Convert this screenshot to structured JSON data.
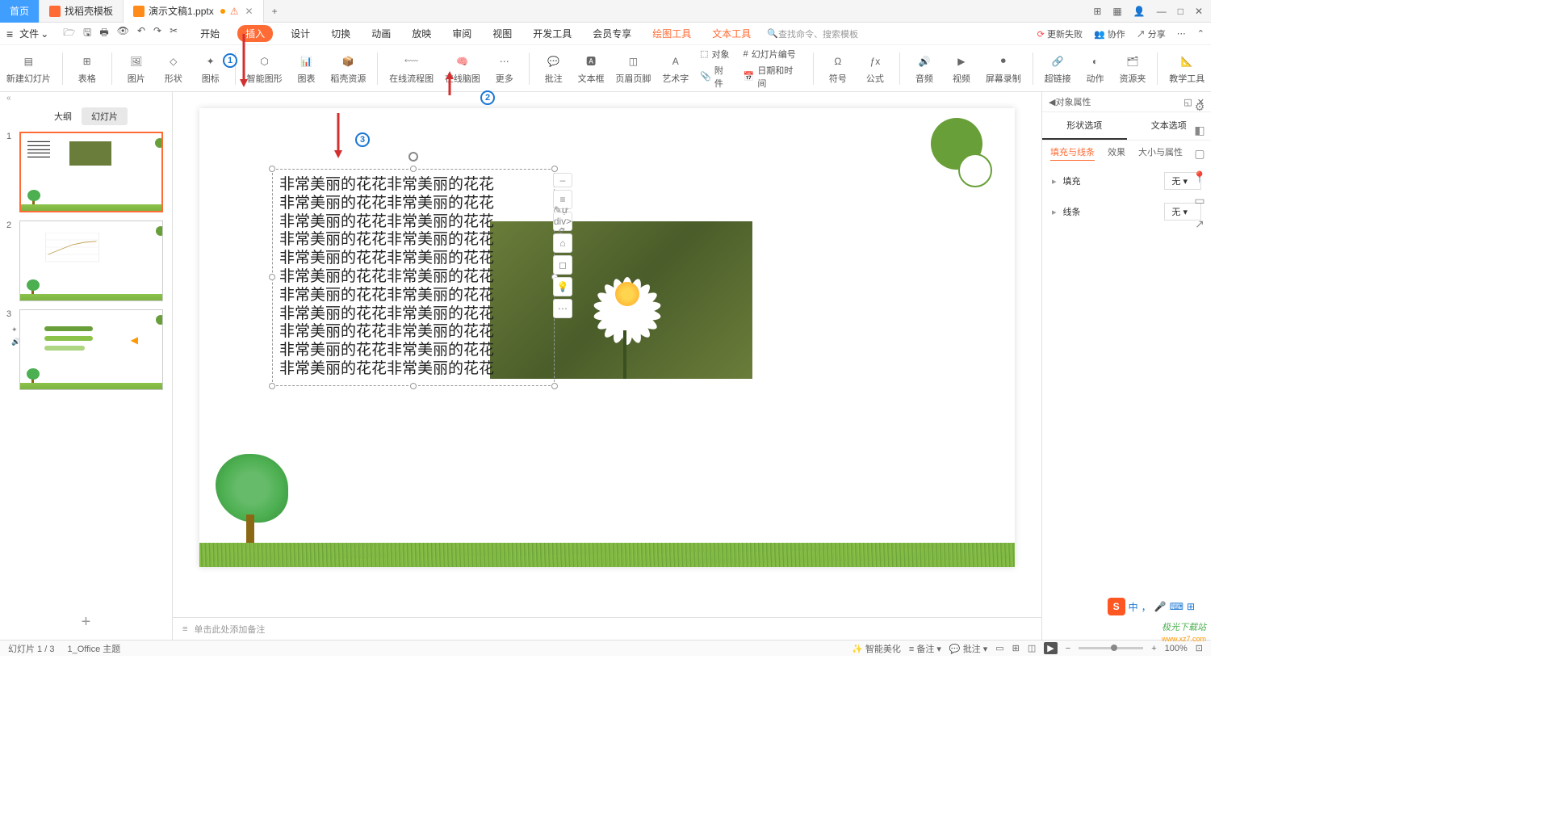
{
  "titlebar": {
    "tabs": [
      {
        "label": "首页"
      },
      {
        "label": "找稻壳模板"
      },
      {
        "label": "演示文稿1.pptx"
      }
    ]
  },
  "menu": {
    "file": "文件",
    "tabs": [
      "开始",
      "插入",
      "设计",
      "切换",
      "动画",
      "放映",
      "审阅",
      "视图",
      "开发工具",
      "会员专享",
      "绘图工具",
      "文本工具"
    ],
    "active_tab": "插入",
    "special_tabs": [
      "绘图工具",
      "文本工具"
    ],
    "search_placeholder": "查找命令、搜索模板",
    "right": {
      "fail": "更新失败",
      "coop": "协作",
      "share": "分享"
    }
  },
  "ribbon": {
    "items": [
      "新建幻灯片",
      "表格",
      "图片",
      "形状",
      "图标",
      "智能图形",
      "图表",
      "稻壳资源",
      "在线流程图",
      "在线脑图",
      "更多",
      "批注",
      "文本框",
      "页眉页脚",
      "艺术字",
      "对象",
      "附件",
      "幻灯片编号",
      "日期和时间",
      "符号",
      "公式",
      "音频",
      "视频",
      "屏幕录制",
      "超链接",
      "动作",
      "资源夹",
      "教学工具"
    ],
    "attach_items": {
      "object": "对象",
      "attach": "附件",
      "slidenum": "幻灯片编号",
      "datetime": "日期和时间"
    }
  },
  "slide_panel": {
    "tabs": [
      "大纲",
      "幻灯片"
    ],
    "active": "幻灯片"
  },
  "text_content": "非常美丽的花花非常美丽的花花",
  "text_lines": 11,
  "right_panel": {
    "title": "对象属性",
    "tabs": [
      "形状选项",
      "文本选项"
    ],
    "active_tab": "形状选项",
    "subtabs": [
      "填充与线条",
      "效果",
      "大小与属性"
    ],
    "active_subtab": "填充与线条",
    "fill_label": "填充",
    "fill_value": "无",
    "line_label": "线条",
    "line_value": "无"
  },
  "notes": "单击此处添加备注",
  "status": {
    "slide": "幻灯片 1 / 3",
    "theme": "1_Office 主题",
    "beautify": "智能美化",
    "notes_btn": "备注",
    "comment_btn": "批注",
    "zoom": "100%"
  },
  "ime": {
    "lang": "中"
  },
  "watermark": "极光下载站",
  "watermark2": "www.xz7.com"
}
